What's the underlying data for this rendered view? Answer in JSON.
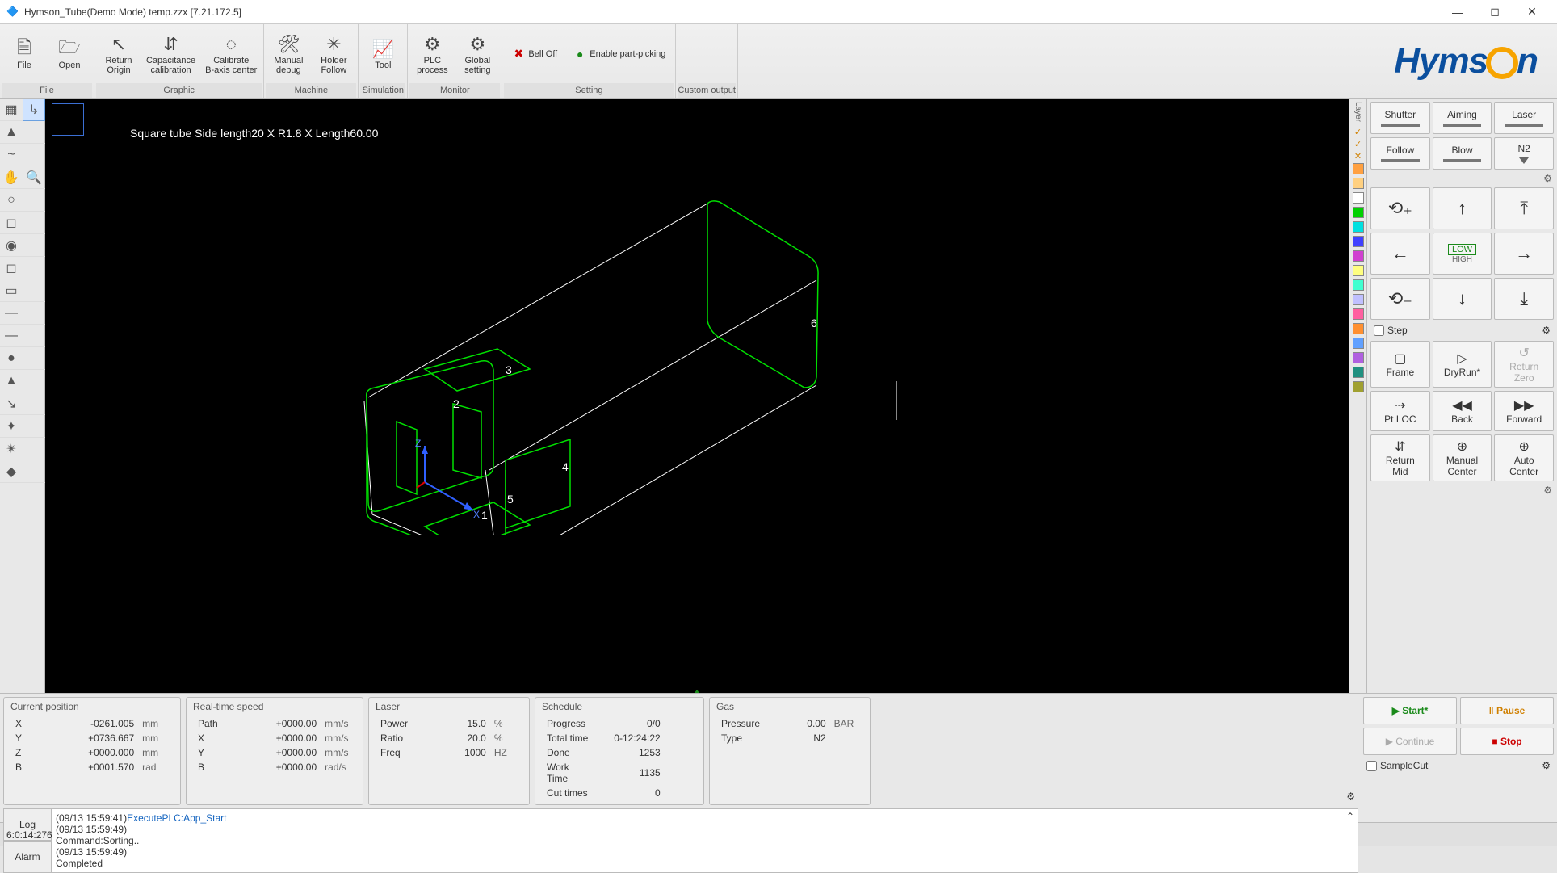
{
  "window": {
    "title": "Hymson_Tube(Demo Mode) temp.zzx  [7.21.172.5]"
  },
  "ribbon": {
    "groups": [
      {
        "label": "File",
        "buttons": [
          {
            "icon": "file-icon",
            "label": "File",
            "glyph": "🗎"
          },
          {
            "icon": "open-icon",
            "label": "Open",
            "glyph": "🗁"
          }
        ]
      },
      {
        "label": "Graphic",
        "buttons": [
          {
            "icon": "return-origin-icon",
            "label": "Return\nOrigin",
            "glyph": "↖"
          },
          {
            "icon": "cap-cal-icon",
            "label": "Capacitance\ncalibration",
            "glyph": "⇵"
          },
          {
            "icon": "calibrate-b-icon",
            "label": "Calibrate\nB-axis center",
            "glyph": "◌"
          }
        ]
      },
      {
        "label": "Machine",
        "buttons": [
          {
            "icon": "manual-debug-icon",
            "label": "Manual\ndebug",
            "glyph": "🛠"
          },
          {
            "icon": "holder-follow-icon",
            "label": "Holder\nFollow",
            "glyph": "✳"
          }
        ]
      },
      {
        "label": "Simulation",
        "buttons": [
          {
            "icon": "tool-icon",
            "label": "Tool",
            "glyph": "📈"
          }
        ]
      },
      {
        "label": "Monitor",
        "buttons": [
          {
            "icon": "plc-icon",
            "label": "PLC\nprocess",
            "glyph": "⚙"
          },
          {
            "icon": "global-icon",
            "label": "Global\nsetting",
            "glyph": "⚙"
          }
        ]
      },
      {
        "label": "Setting",
        "buttons": [
          {
            "icon": "bell-off-icon",
            "label": "Bell Off",
            "glyph": "✖",
            "small": true,
            "color": "#c00"
          },
          {
            "icon": "part-pick-icon",
            "label": "Enable part-picking",
            "glyph": "●",
            "small": true,
            "color": "#1a8a1a"
          }
        ]
      },
      {
        "label": "Custom output",
        "buttons": []
      }
    ]
  },
  "leftTools": [
    [
      "▦",
      "▲",
      "~",
      "✋",
      "○",
      "◻",
      "◉",
      "◻",
      "▭",
      "—",
      "—",
      "●",
      "▲",
      "↘",
      "✦",
      "✴",
      "◆"
    ],
    [
      "↳",
      "",
      "",
      "🔍",
      "",
      "",
      "",
      "",
      "",
      "",
      "",
      "",
      "",
      "",
      "",
      "",
      ""
    ]
  ],
  "canvas": {
    "caption": "Square tube Side length20 X R1.8 X Length60.00",
    "nums": [
      "1",
      "2",
      "3",
      "4",
      "5",
      "6"
    ],
    "axes": {
      "x": "X",
      "z": "Z"
    }
  },
  "layerColors": [
    "#ffa040",
    "#ffd080",
    "#ffffff",
    "#00d000",
    "#00e0e0",
    "#4040ff",
    "#d040d0",
    "#ffff80",
    "#40ffd0",
    "#c0c0ff",
    "#ff60a0",
    "#ff9030",
    "#60a0ff",
    "#b060e0",
    "#209080",
    "#a0a030"
  ],
  "right": {
    "row1": [
      "Shutter",
      "Aiming",
      "Laser"
    ],
    "row2": [
      "Follow",
      "Blow",
      "N2"
    ],
    "speed": {
      "low": "LOW",
      "high": "HIGH"
    },
    "step": "Step",
    "ops": [
      [
        "Frame",
        "DryRun*",
        "Return\nZero"
      ],
      [
        "Pt LOC",
        "Back",
        "Forward"
      ],
      [
        "Return\nMid",
        "Manual\nCenter",
        "Auto\nCenter"
      ]
    ],
    "actions": {
      "start": "Start*",
      "pause": "Pause",
      "continue": "Continue",
      "stop": "Stop",
      "sampleCut": "SampleCut"
    }
  },
  "status": {
    "curpos": {
      "title": "Current position",
      "rows": [
        [
          "X",
          "-0261.005",
          "mm"
        ],
        [
          "Y",
          "+0736.667",
          "mm"
        ],
        [
          "Z",
          "+0000.000",
          "mm"
        ],
        [
          "B",
          "+0001.570",
          "rad"
        ]
      ]
    },
    "speed": {
      "title": "Real-time speed",
      "rows": [
        [
          "Path",
          "+0000.00",
          "mm/s"
        ],
        [
          "X",
          "+0000.00",
          "mm/s"
        ],
        [
          "Y",
          "+0000.00",
          "mm/s"
        ],
        [
          "B",
          "+0000.00",
          "rad/s"
        ]
      ]
    },
    "laser": {
      "title": "Laser",
      "rows": [
        [
          "Power",
          "15.0",
          "%"
        ],
        [
          "Ratio",
          "20.0",
          "%"
        ],
        [
          "Freq",
          "1000",
          "HZ"
        ]
      ]
    },
    "sched": {
      "title": "Schedule",
      "rows": [
        [
          "Progress",
          "0/0",
          ""
        ],
        [
          "Total time",
          "0-12:24:22",
          ""
        ],
        [
          "Done",
          "1253",
          ""
        ],
        [
          "Work Time",
          "1135",
          ""
        ],
        [
          "Cut times",
          "0",
          ""
        ]
      ]
    },
    "gas": {
      "title": "Gas",
      "rows": [
        [
          "Pressure",
          "0.00",
          "BAR"
        ],
        [
          "Type",
          "N2",
          ""
        ]
      ]
    }
  },
  "log": {
    "tabs": [
      "Log",
      "Alarm"
    ],
    "lines": [
      {
        "ts": "(09/13 15:59:41)",
        "cmd": "ExecutePLC:App_Start"
      },
      {
        "ts": "(09/13 15:59:49)",
        "cmd": ""
      },
      {
        "ts": "Command:Sorting..",
        "cmd": ""
      },
      {
        "ts": "(09/13 15:59:49)",
        "cmd": ""
      },
      {
        "ts": "Completed",
        "cmd": ""
      }
    ]
  },
  "footer": {
    "left": "6:0:14:276",
    "right": ""
  }
}
